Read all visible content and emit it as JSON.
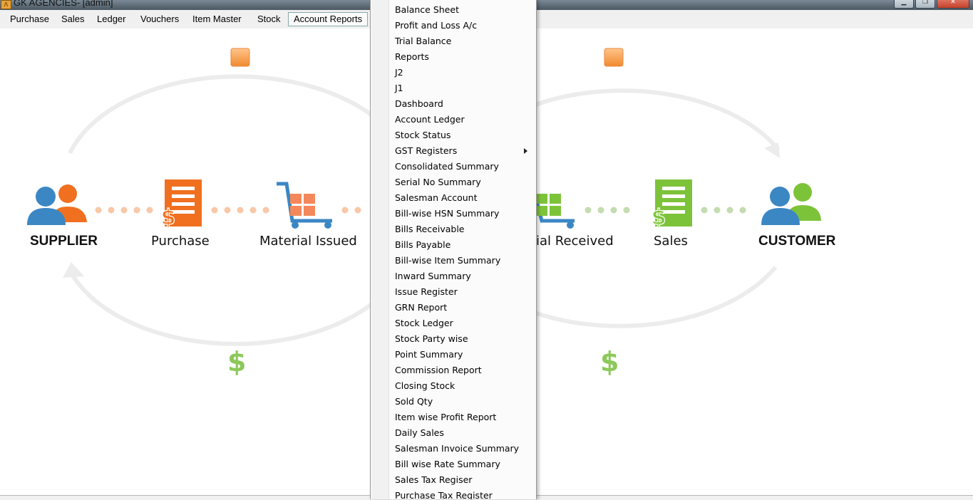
{
  "window": {
    "title": "GK AGENCIES- [admin]"
  },
  "menubar": {
    "items": [
      {
        "label": "Purchase"
      },
      {
        "label": "Sales"
      },
      {
        "label": "Ledger"
      },
      {
        "label": "Vouchers"
      },
      {
        "label": "Item Master"
      },
      {
        "label": "Stock"
      },
      {
        "label": "Account Reports"
      }
    ]
  },
  "diagram": {
    "supplier": "SUPPLIER",
    "purchase": "Purchase",
    "material_issued": "Material Issued",
    "material_received": "ial Received",
    "sales": "Sales",
    "customer": "CUSTOMER",
    "dollar": "$",
    "colors": {
      "orange": "#f07020",
      "green": "#7dc33a",
      "blue": "#3b87c4"
    }
  },
  "dropdown": {
    "items": [
      {
        "label": "Balance Sheet"
      },
      {
        "label": "Profit and Loss A/c"
      },
      {
        "label": "Trial Balance"
      },
      {
        "label": "Reports"
      },
      {
        "label": "J2"
      },
      {
        "label": "J1"
      },
      {
        "label": "Dashboard"
      },
      {
        "label": "Account Ledger"
      },
      {
        "label": "Stock Status"
      },
      {
        "label": "GST Registers",
        "submenu": true
      },
      {
        "label": "Consolidated Summary"
      },
      {
        "label": "Serial No Summary"
      },
      {
        "label": "Salesman Account"
      },
      {
        "label": "Bill-wise HSN Summary"
      },
      {
        "label": "Bills Receivable"
      },
      {
        "label": "Bills Payable"
      },
      {
        "label": "Bill-wise Item Summary"
      },
      {
        "label": "Inward Summary"
      },
      {
        "label": "Issue Register"
      },
      {
        "label": "GRN Report"
      },
      {
        "label": "Stock Ledger"
      },
      {
        "label": "Stock Party wise"
      },
      {
        "label": "Point Summary"
      },
      {
        "label": "Commission Report"
      },
      {
        "label": "Closing Stock"
      },
      {
        "label": "Sold Qty"
      },
      {
        "label": "Item wise Profit Report"
      },
      {
        "label": "Daily Sales"
      },
      {
        "label": "Salesman Invoice Summary"
      },
      {
        "label": "Bill wise Rate Summary"
      },
      {
        "label": "Sales Tax Regiser"
      },
      {
        "label": "Purchase Tax Register"
      }
    ]
  }
}
